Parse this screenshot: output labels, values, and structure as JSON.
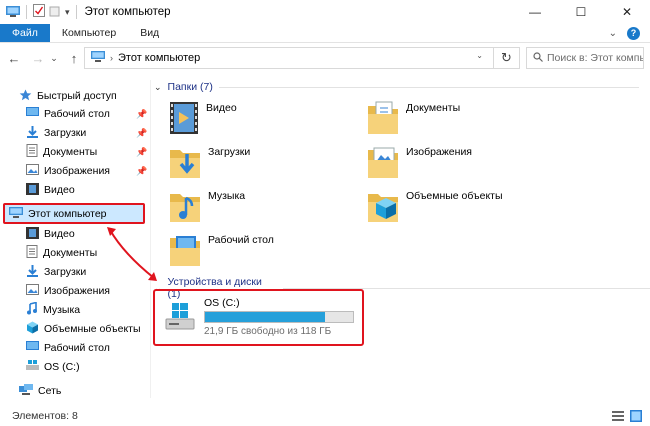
{
  "window": {
    "title": "Этот компьютер",
    "minimize": "—",
    "maximize": "☐",
    "close": "✕"
  },
  "ribbon": {
    "tabs": [
      {
        "label": "Файл"
      },
      {
        "label": "Компьютер"
      },
      {
        "label": "Вид"
      }
    ]
  },
  "address": {
    "path": "Этот компьютер",
    "search_placeholder": "Поиск в: Этот компьютер"
  },
  "nav": {
    "quick_access": "Быстрый доступ",
    "quick_items": [
      {
        "label": "Рабочий стол",
        "icon": "desktop-icon",
        "pinned": true
      },
      {
        "label": "Загрузки",
        "icon": "download-icon",
        "pinned": true
      },
      {
        "label": "Документы",
        "icon": "documents-icon",
        "pinned": true
      },
      {
        "label": "Изображения",
        "icon": "pictures-icon",
        "pinned": true
      },
      {
        "label": "Видео",
        "icon": "video-icon",
        "pinned": false
      }
    ],
    "this_pc": "Этот компьютер",
    "pc_items": [
      {
        "label": "Видео",
        "icon": "video-icon"
      },
      {
        "label": "Документы",
        "icon": "documents-icon"
      },
      {
        "label": "Загрузки",
        "icon": "download-icon"
      },
      {
        "label": "Изображения",
        "icon": "pictures-icon"
      },
      {
        "label": "Музыка",
        "icon": "music-icon"
      },
      {
        "label": "Объемные объекты",
        "icon": "3d-objects-icon"
      },
      {
        "label": "Рабочий стол",
        "icon": "desktop-icon"
      },
      {
        "label": "OS (C:)",
        "icon": "drive-icon"
      }
    ],
    "network": "Сеть"
  },
  "content": {
    "folders_header": "Папки (7)",
    "folders": [
      {
        "label": "Видео",
        "icon": "video-folder-icon"
      },
      {
        "label": "Документы",
        "icon": "documents-folder-icon"
      },
      {
        "label": "Загрузки",
        "icon": "downloads-folder-icon"
      },
      {
        "label": "Изображения",
        "icon": "pictures-folder-icon"
      },
      {
        "label": "Музыка",
        "icon": "music-folder-icon"
      },
      {
        "label": "Объемные объекты",
        "icon": "3d-objects-folder-icon"
      },
      {
        "label": "Рабочий стол",
        "icon": "desktop-folder-icon"
      }
    ],
    "drives_header": "Устройства и диски (1)",
    "drive": {
      "name": "OS (C:)",
      "free_text": "21,9 ГБ свободно из 118 ГБ",
      "used_fraction": 0.814,
      "bar_color": "#26a0da"
    }
  },
  "status": {
    "items_text": "Элементов: 8"
  },
  "colors": {
    "accent": "#1979ca",
    "highlight_border": "#e0141e",
    "selection": "#cce8ff"
  }
}
